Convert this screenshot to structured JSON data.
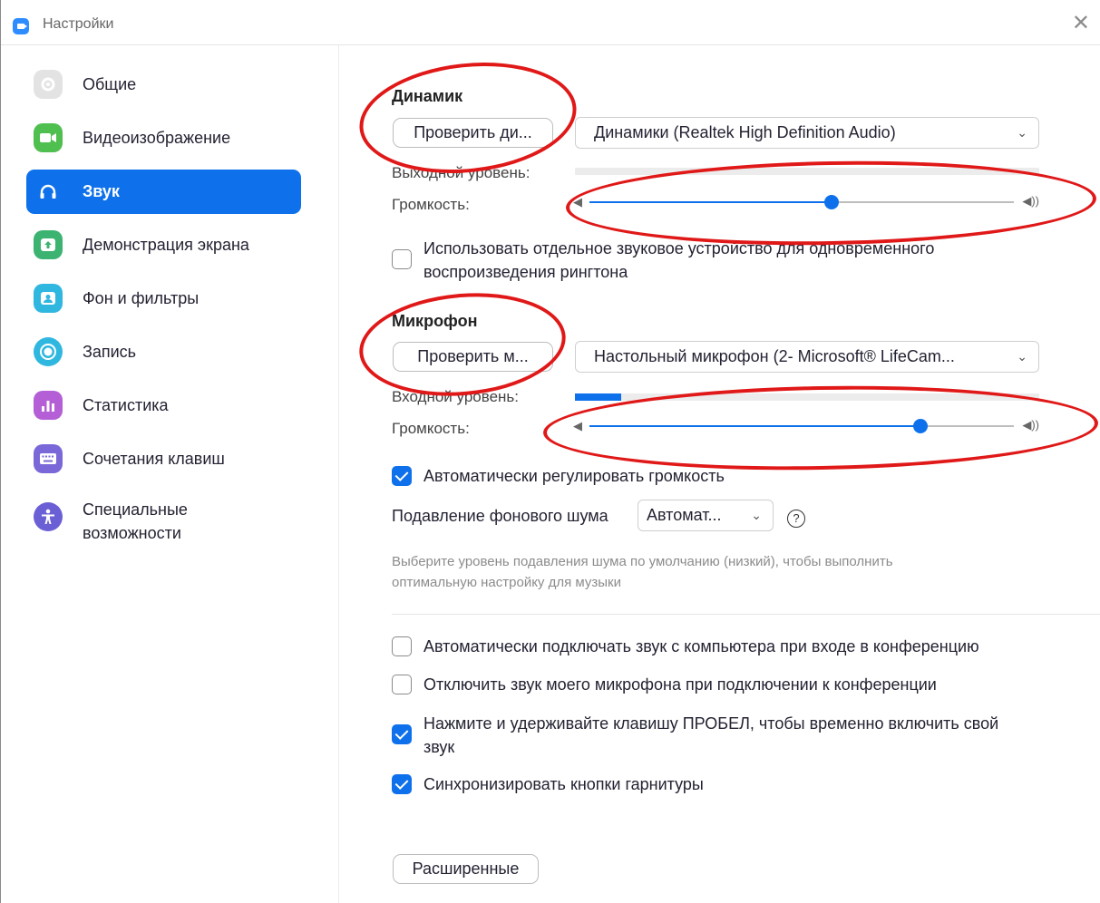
{
  "window": {
    "title": "Настройки",
    "close_glyph": "✕"
  },
  "sidebar": {
    "items": [
      {
        "label": "Общие",
        "icon": "gear-icon",
        "color": "#dcdcdc"
      },
      {
        "label": "Видеоизображение",
        "icon": "video-camera-icon",
        "color": "#4fbf4f"
      },
      {
        "label": "Звук",
        "icon": "headphones-icon",
        "color": "#0e71eb",
        "active": true
      },
      {
        "label": "Демонстрация экрана",
        "icon": "share-screen-icon",
        "color": "#3cb371"
      },
      {
        "label": "Фон и фильтры",
        "icon": "background-person-icon",
        "color": "#2fb7e0"
      },
      {
        "label": "Запись",
        "icon": "record-icon",
        "color": "#2fb7e0"
      },
      {
        "label": "Статистика",
        "icon": "statistics-icon",
        "color": "#b45fd6"
      },
      {
        "label": "Сочетания клавиш",
        "icon": "keyboard-icon",
        "color": "#7a68d8"
      },
      {
        "label_line1": "Специальные",
        "label_line2": "возможности",
        "icon": "accessibility-icon",
        "color": "#6b5fd6"
      }
    ]
  },
  "speaker": {
    "title": "Динамик",
    "test_button": "Проверить ди...",
    "device": "Динамики (Realtek High Definition Audio)",
    "output_level_label": "Выходной уровень:",
    "output_level": 0,
    "volume_label": "Громкость:",
    "volume": 0.57
  },
  "ringtone_checkbox": {
    "line1": "Использовать отдельное звуковое устройство для одновременного",
    "line2": "воспроизведения рингтона",
    "checked": false
  },
  "microphone": {
    "title": "Микрофон",
    "test_button": "Проверить м...",
    "device": "Настольный микрофон (2- Microsoft® LifeCam...",
    "input_level_label": "Входной уровень:",
    "input_level": 0.1,
    "volume_label": "Громкость:",
    "volume": 0.78
  },
  "auto_volume": {
    "label": "Автоматически регулировать громкость",
    "checked": true
  },
  "noise_suppression": {
    "label": "Подавление фонового шума",
    "value": "Автомат...",
    "help": "?",
    "hint_line1": "Выберите уровень подавления шума по умолчанию (низкий), чтобы выполнить",
    "hint_line2": "оптимальную настройку для музыки"
  },
  "options": [
    {
      "label": "Автоматически подключать звук с компьютера при входе в конференцию",
      "checked": false
    },
    {
      "label": "Отключить звук моего микрофона при подключении к конференции",
      "checked": false
    },
    {
      "line1": "Нажмите и удерживайте клавишу ПРОБЕЛ, чтобы временно включить свой",
      "line2": "звук",
      "checked": true
    },
    {
      "label": "Синхронизировать кнопки гарнитуры",
      "checked": true
    }
  ],
  "advanced_button": "Расширенные",
  "annotation_color": "#e01818"
}
